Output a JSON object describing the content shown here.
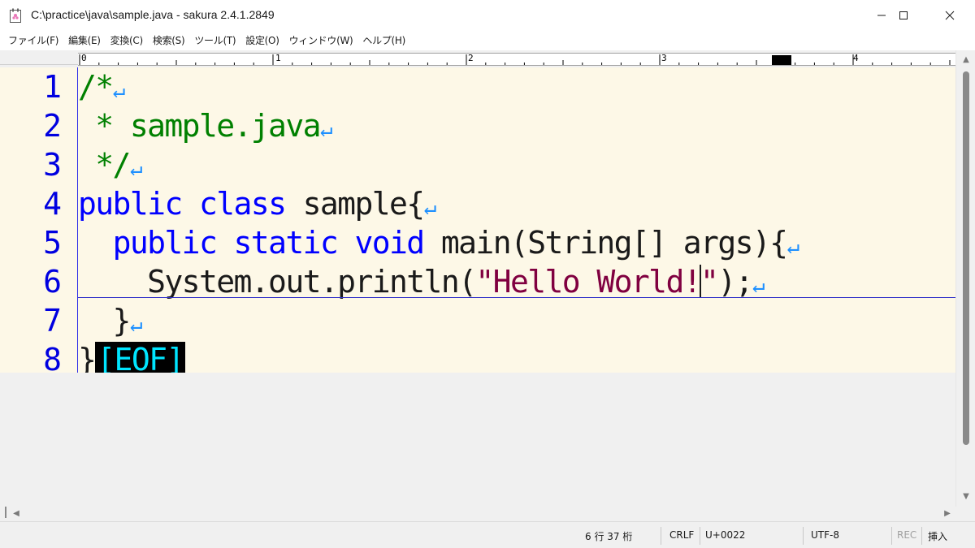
{
  "window": {
    "title": "C:\\practice\\java\\sample.java - sakura 2.4.1.2849",
    "app_icon": "sakura-notepad-icon",
    "controls": [
      "minimize-icon",
      "maximize-icon",
      "close-icon"
    ]
  },
  "menu": {
    "items": [
      {
        "label": "ファイル(F)"
      },
      {
        "label": "編集(E)"
      },
      {
        "label": "変換(C)"
      },
      {
        "label": "検索(S)"
      },
      {
        "label": "ツール(T)"
      },
      {
        "label": "設定(O)"
      },
      {
        "label": "ウィンドウ(W)"
      },
      {
        "label": "ヘルプ(H)"
      }
    ]
  },
  "ruler": {
    "labels": [
      "0",
      "1",
      "2",
      "3",
      "4"
    ]
  },
  "editor": {
    "line_numbers": [
      "1",
      "2",
      "3",
      "4",
      "5",
      "6",
      "7",
      "8"
    ],
    "lines": [
      {
        "segments": [
          {
            "t": "/*",
            "c": "cm"
          }
        ],
        "ret": true
      },
      {
        "segments": [
          {
            "t": " * sample.java",
            "c": "cm"
          }
        ],
        "ret": true
      },
      {
        "segments": [
          {
            "t": " */",
            "c": "cm"
          }
        ],
        "ret": true
      },
      {
        "segments": [
          {
            "t": "public",
            "c": "kw"
          },
          {
            "t": " ",
            "c": ""
          },
          {
            "t": "class",
            "c": "kw"
          },
          {
            "t": " sample{",
            "c": ""
          }
        ],
        "ret": true
      },
      {
        "segments": [
          {
            "t": "  ",
            "c": ""
          },
          {
            "t": "public",
            "c": "kw"
          },
          {
            "t": " ",
            "c": ""
          },
          {
            "t": "static",
            "c": "kw"
          },
          {
            "t": " ",
            "c": ""
          },
          {
            "t": "void",
            "c": "kw"
          },
          {
            "t": " main(String[] args){",
            "c": ""
          }
        ],
        "ret": true
      },
      {
        "segments": [
          {
            "t": "    System.out.println(",
            "c": ""
          },
          {
            "t": "\"Hello World!",
            "c": "st"
          },
          {
            "t": "CARET",
            "c": "caret"
          },
          {
            "t": "\"",
            "c": "st"
          },
          {
            "t": ");",
            "c": ""
          }
        ],
        "ret": true
      },
      {
        "segments": [
          {
            "t": "  }",
            "c": ""
          }
        ],
        "ret": true
      },
      {
        "segments": [
          {
            "t": "}",
            "c": ""
          },
          {
            "t": "[EOF]",
            "c": "eof"
          }
        ],
        "ret": false
      }
    ],
    "return_glyph": "↵",
    "cursor_line": 6,
    "colors": {
      "background": "#fdf8e7",
      "keyword": "#0000ff",
      "comment": "#008000",
      "string": "#800040",
      "line_number": "#0000e0",
      "return_mark": "#1e90ff",
      "eof_fg": "#00e5ff",
      "eof_bg": "#000000"
    }
  },
  "status": {
    "position": "6 行  37 桁",
    "line_ending": "CRLF",
    "char_code": "U+0022",
    "encoding": "UTF-8",
    "rec": "REC",
    "insert_mode": "挿入"
  }
}
